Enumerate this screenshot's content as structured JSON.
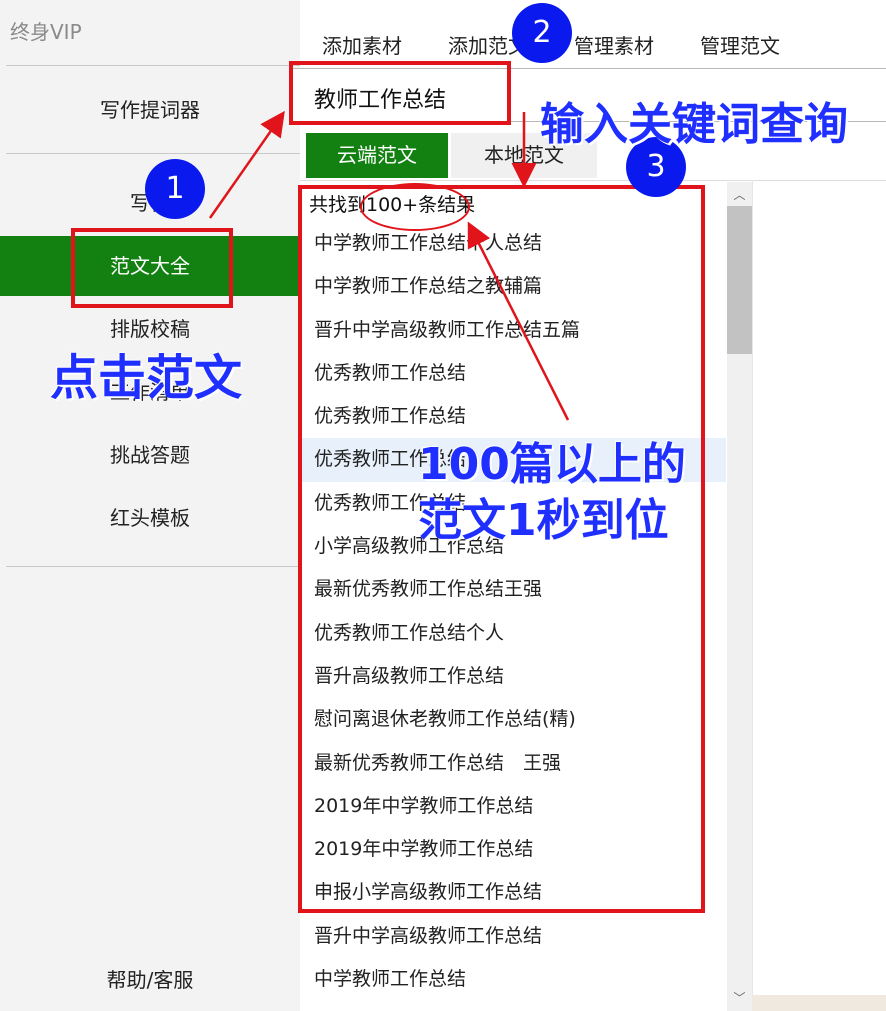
{
  "sidebar": {
    "vip_label": "终身VIP",
    "items": [
      {
        "label": "写作提词器"
      },
      {
        "label": "写作"
      },
      {
        "label": "范文大全"
      },
      {
        "label": "排版校稿"
      },
      {
        "label": "工作清单"
      },
      {
        "label": "挑战答题"
      },
      {
        "label": "红头模板"
      }
    ],
    "help_label": "帮助/客服",
    "active_color": "#128112"
  },
  "top_tabs": [
    "添加素材",
    "添加范文",
    "管理素材",
    "管理范文"
  ],
  "search": {
    "value": "教师工作总结"
  },
  "segments": {
    "cloud": "云端范文",
    "local": "本地范文"
  },
  "results": {
    "count_text": "共找到100+条结果",
    "items": [
      "中学教师工作总结个人总结",
      "中学教师工作总结之教辅篇",
      "晋升中学高级教师工作总结五篇",
      "优秀教师工作总结",
      "优秀教师工作总结",
      "优秀教师工作总结",
      "优秀教师工作总结",
      "小学高级教师工作总结",
      "最新优秀教师工作总结王强",
      "优秀教师工作总结个人",
      "晋升高级教师工作总结",
      "慰问离退休老教师工作总结(精)",
      "最新优秀教师工作总结　王强",
      "2019年中学教师工作总结",
      "2019年中学教师工作总结",
      "申报小学高级教师工作总结",
      "晋升中学高级教师工作总结",
      "中学教师工作总结"
    ]
  },
  "annotations": {
    "badge1": "1",
    "badge2": "2",
    "badge3": "3",
    "click_note": "点击范文",
    "search_note": "输入关键词查询",
    "result_note_line1": "100篇以上的",
    "result_note_line2": "范文1秒到位",
    "mark_color": "#e0141a",
    "badge_color": "#0a1aee"
  }
}
